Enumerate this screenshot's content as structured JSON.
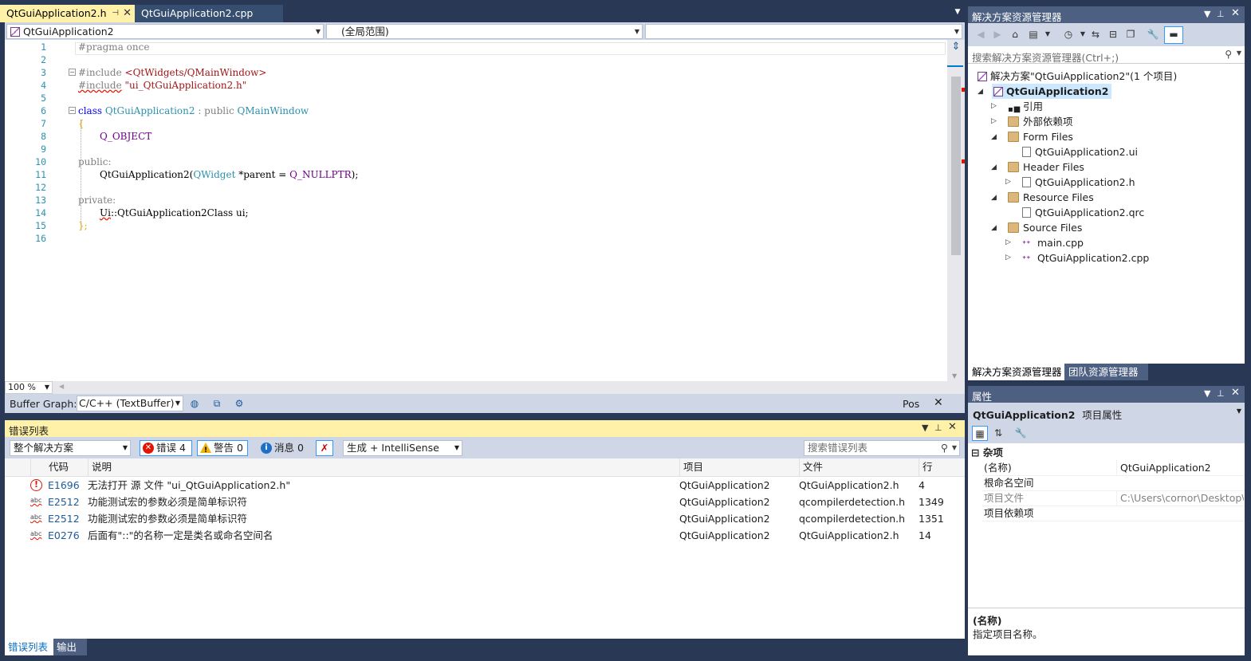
{
  "editor": {
    "tabs": [
      {
        "label": "QtGuiApplication2.h",
        "active": true
      },
      {
        "label": "QtGuiApplication2.cpp",
        "active": false
      }
    ],
    "nav": {
      "project": "QtGuiApplication2",
      "scope": "(全局范围)",
      "member": ""
    },
    "lines": [
      "1",
      "2",
      "3",
      "4",
      "5",
      "6",
      "7",
      "8",
      "9",
      "10",
      "11",
      "12",
      "13",
      "14",
      "15",
      "16"
    ],
    "code": {
      "l1": "#pragma once",
      "l3_a": "#include ",
      "l3_b": "<QtWidgets/QMainWindow>",
      "l4_a": "#include",
      "l4_b": " \"ui_QtGuiApplication2.h\"",
      "l6_kw": "class",
      "l6_cls": "QtGuiApplication2",
      "l6_mid": " : public ",
      "l6_base": "QMainWindow",
      "l7": "{",
      "l8": "Q_OBJECT",
      "l10": "public:",
      "l11_a": "QtGuiApplication2(",
      "l11_t": "QWidget",
      "l11_b": " *parent = ",
      "l11_m": "Q_NULLPTR",
      "l11_c": ");",
      "l13": "private:",
      "l14_a": "Ui",
      "l14_b": "::QtGuiApplication2Class ui;",
      "l15": "};"
    },
    "zoom": "100 %",
    "buffer_graph_label": "Buffer Graph:",
    "buffer_graph_value": "C/C++ (TextBuffer)",
    "pos_label": "Pos"
  },
  "error_list": {
    "title": "错误列表",
    "scope": "整个解决方案",
    "errors_label": "错误 4",
    "warnings_label": "警告 0",
    "messages_label": "消息 0",
    "build_filter": "生成 + IntelliSense",
    "search_placeholder": "搜索错误列表",
    "columns": {
      "code": "代码",
      "desc": "说明",
      "project": "项目",
      "file": "文件",
      "line": "行"
    },
    "rows": [
      {
        "kind": "error",
        "code": "E1696",
        "desc": "无法打开 源 文件 \"ui_QtGuiApplication2.h\"",
        "project": "QtGuiApplication2",
        "file": "QtGuiApplication2.h",
        "line": "4"
      },
      {
        "kind": "abc",
        "code": "E2512",
        "desc": "功能测试宏的参数必须是简单标识符",
        "project": "QtGuiApplication2",
        "file": "qcompilerdetection.h",
        "line": "1349"
      },
      {
        "kind": "abc",
        "code": "E2512",
        "desc": "功能测试宏的参数必须是简单标识符",
        "project": "QtGuiApplication2",
        "file": "qcompilerdetection.h",
        "line": "1351"
      },
      {
        "kind": "abc",
        "code": "E0276",
        "desc": "后面有\"::\"的名称一定是类名或命名空间名",
        "project": "QtGuiApplication2",
        "file": "QtGuiApplication2.h",
        "line": "14"
      }
    ],
    "abc_icon_text": "abc",
    "bottom_tabs": [
      "错误列表",
      "输出"
    ]
  },
  "solution_explorer": {
    "title": "解决方案资源管理器",
    "search_placeholder": "搜索解决方案资源管理器(Ctrl+;)",
    "solution": "解决方案\"QtGuiApplication2\"(1 个项目)",
    "project": "QtGuiApplication2",
    "references": "引用",
    "external_deps": "外部依赖项",
    "form_files": "Form Files",
    "form_file_1": "QtGuiApplication2.ui",
    "header_files": "Header Files",
    "header_file_1": "QtGuiApplication2.h",
    "resource_files": "Resource Files",
    "resource_file_1": "QtGuiApplication2.qrc",
    "source_files": "Source Files",
    "source_file_1": "main.cpp",
    "source_file_2": "QtGuiApplication2.cpp",
    "tabs": [
      "解决方案资源管理器",
      "团队资源管理器"
    ]
  },
  "properties": {
    "title": "属性",
    "object_name": "QtGuiApplication2",
    "object_type": "项目属性",
    "category": "杂项",
    "rows": [
      {
        "key": "(名称)",
        "value": "QtGuiApplication2",
        "dim": false
      },
      {
        "key": "根命名空间",
        "value": "",
        "dim": false
      },
      {
        "key": "项目文件",
        "value": "C:\\Users\\cornor\\Desktop\\QtG",
        "dim": true
      },
      {
        "key": "项目依赖项",
        "value": "",
        "dim": false
      }
    ],
    "desc_name": "(名称)",
    "desc_text": "指定项目名称。"
  }
}
